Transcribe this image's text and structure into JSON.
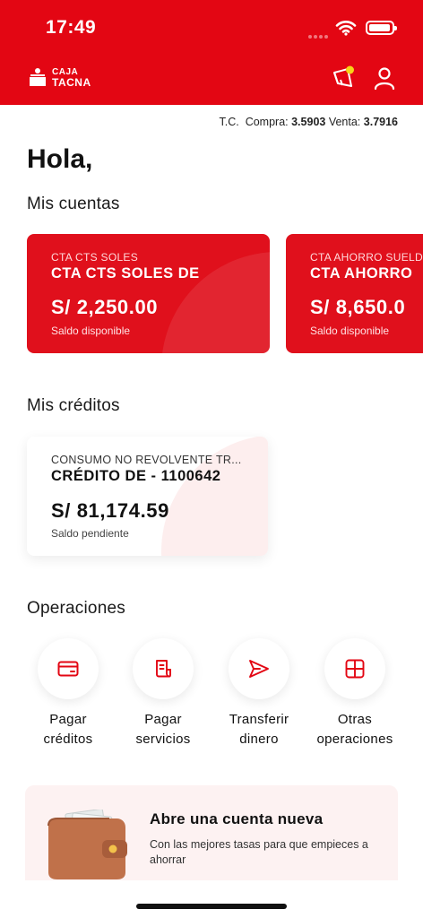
{
  "status_bar": {
    "time": "17:49"
  },
  "header": {
    "logo": {
      "line1": "CAJA",
      "line2": "TACNA"
    },
    "icons": [
      "notification-icon",
      "user-icon"
    ],
    "brand_color": "#e30613"
  },
  "exchange_rate": {
    "prefix": "T.C.",
    "buy_label": "Compra:",
    "buy_value": "3.5903",
    "sell_label": "Venta:",
    "sell_value": "3.7916"
  },
  "greeting": "Hola,",
  "accounts": {
    "title": "Mis cuentas",
    "items": [
      {
        "type": "CTA CTS SOLES",
        "name": "CTA CTS SOLES DE",
        "amount": "S/ 2,250.00",
        "label": "Saldo disponible"
      },
      {
        "type": "CTA AHORRO SUELD",
        "name": "CTA AHORRO",
        "amount": "S/ 8,650.0",
        "label": "Saldo disponible"
      }
    ]
  },
  "credits": {
    "title": "Mis créditos",
    "items": [
      {
        "type": "CONSUMO NO REVOLVENTE TR...",
        "name": "CRÉDITO DE  - 1100642",
        "amount": "S/ 81,174.59",
        "label": "Saldo pendiente"
      }
    ]
  },
  "operations": {
    "title": "Operaciones",
    "items": [
      {
        "icon": "card-icon",
        "line1": "Pagar",
        "line2": "créditos"
      },
      {
        "icon": "receipt-icon",
        "line1": "Pagar",
        "line2": "servicios"
      },
      {
        "icon": "send-icon",
        "line1": "Transferir",
        "line2": "dinero"
      },
      {
        "icon": "grid-icon",
        "line1": "Otras",
        "line2": "operaciones"
      }
    ]
  },
  "promo": {
    "icon": "wallet-icon",
    "title": "Abre una cuenta nueva",
    "description": "Con las mejores tasas para que empieces a ahorrar"
  }
}
